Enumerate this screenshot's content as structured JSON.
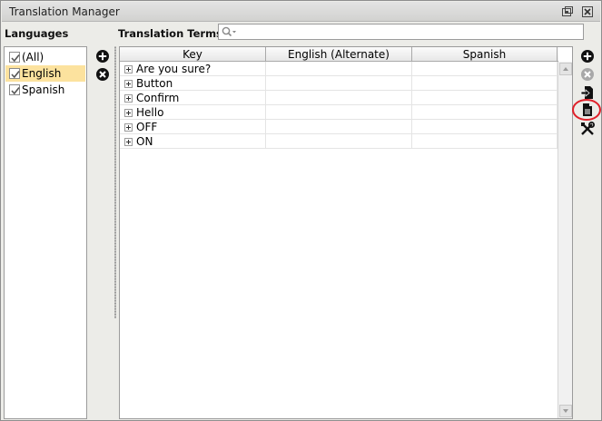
{
  "window": {
    "title": "Translation Manager"
  },
  "languages": {
    "heading": "Languages",
    "items": [
      {
        "label": "(All)",
        "checked": true,
        "selected": false
      },
      {
        "label": "English",
        "checked": true,
        "selected": true
      },
      {
        "label": "Spanish",
        "checked": true,
        "selected": false
      }
    ]
  },
  "terms": {
    "heading": "Translation Terms",
    "search_value": "",
    "columns": [
      "Key",
      "English (Alternate)",
      "Spanish"
    ],
    "rows": [
      {
        "key": "Are you sure?",
        "english_alt": "",
        "spanish": ""
      },
      {
        "key": "Button",
        "english_alt": "",
        "spanish": ""
      },
      {
        "key": "Confirm",
        "english_alt": "",
        "spanish": ""
      },
      {
        "key": "Hello",
        "english_alt": "",
        "spanish": ""
      },
      {
        "key": "OFF",
        "english_alt": "",
        "spanish": ""
      },
      {
        "key": "ON",
        "english_alt": "",
        "spanish": ""
      }
    ]
  },
  "icons": {
    "restore": "restore-window-icon",
    "close": "close-window-icon",
    "add_language": "add-circle-icon",
    "remove_language": "remove-circle-icon",
    "add_term": "add-circle-icon",
    "remove_term": "remove-circle-disabled-icon",
    "import": "import-icon",
    "export": "export-document-icon",
    "tools": "tools-icon",
    "search": "search-icon"
  },
  "colors": {
    "selection": "#fce29e",
    "highlight_ring": "#e0202a"
  }
}
